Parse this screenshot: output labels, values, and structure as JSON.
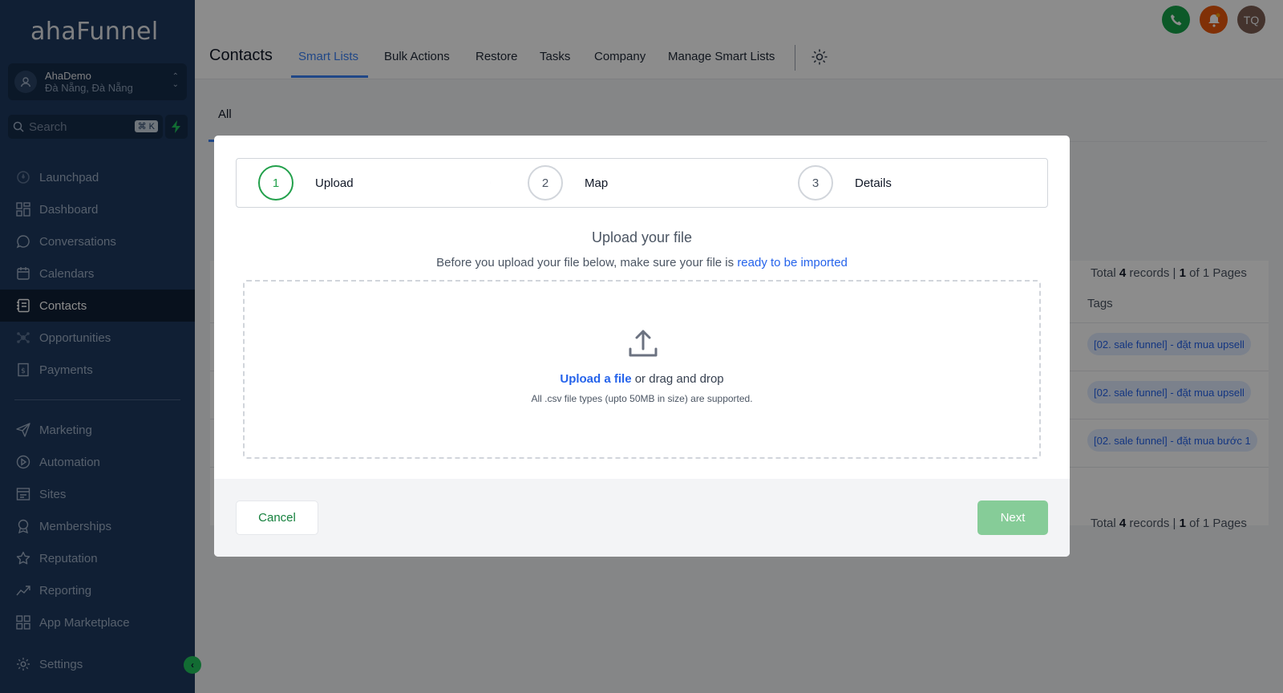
{
  "app": {
    "logo": "ahaFunnel"
  },
  "location": {
    "name": "AhaDemo",
    "address": "Đà Nẵng, Đà Nẵng"
  },
  "search": {
    "placeholder": "Search",
    "shortcut": "⌘ K"
  },
  "sidebar": {
    "items": [
      {
        "label": "Launchpad",
        "icon": "rocket-icon"
      },
      {
        "label": "Dashboard",
        "icon": "grid-icon"
      },
      {
        "label": "Conversations",
        "icon": "chat-icon"
      },
      {
        "label": "Calendars",
        "icon": "calendar-icon"
      },
      {
        "label": "Contacts",
        "icon": "contacts-icon",
        "active": true
      },
      {
        "label": "Opportunities",
        "icon": "opportunities-icon"
      },
      {
        "label": "Payments",
        "icon": "payments-icon"
      },
      {
        "label": "Marketing",
        "icon": "send-icon"
      },
      {
        "label": "Automation",
        "icon": "automation-icon"
      },
      {
        "label": "Sites",
        "icon": "sites-icon"
      },
      {
        "label": "Memberships",
        "icon": "membership-icon"
      },
      {
        "label": "Reputation",
        "icon": "star-icon"
      },
      {
        "label": "Reporting",
        "icon": "trend-icon"
      },
      {
        "label": "App Marketplace",
        "icon": "apps-icon"
      },
      {
        "label": "Settings",
        "icon": "gear-icon"
      }
    ]
  },
  "header": {
    "title": "Contacts",
    "tabs": [
      "Smart Lists",
      "Bulk Actions",
      "Restore",
      "Tasks",
      "Company",
      "Manage Smart Lists"
    ],
    "active_tab": "Smart Lists",
    "user_initials": "TQ"
  },
  "content": {
    "list_tab": "All",
    "total_prefix": "Total",
    "total_records": "4",
    "records_word": "records |",
    "page_current": "1",
    "page_of": "of 1 Pages",
    "tags_header": "Tags",
    "tags": [
      "[02. sale funnel] - đặt mua upsell",
      "[02. sale funnel] - đặt mua upsell",
      "[02. sale funnel] - đặt mua bước 1"
    ]
  },
  "modal": {
    "steps": [
      {
        "num": "1",
        "label": "Upload"
      },
      {
        "num": "2",
        "label": "Map"
      },
      {
        "num": "3",
        "label": "Details"
      }
    ],
    "title": "Upload your file",
    "subtitle": "Before you upload your file below, make sure your file is",
    "subtitle_link": "ready to be imported",
    "upload_link": "Upload a file",
    "upload_rest": "or drag and drop",
    "upload_note": "All .csv file types (upto 50MB in size) are supported.",
    "cancel_label": "Cancel",
    "next_label": "Next"
  },
  "colors": {
    "sidebar": "#1e3a5f",
    "accent_blue": "#3b82f6",
    "success_green": "#22a04b",
    "next_disabled": "#86cc98"
  }
}
